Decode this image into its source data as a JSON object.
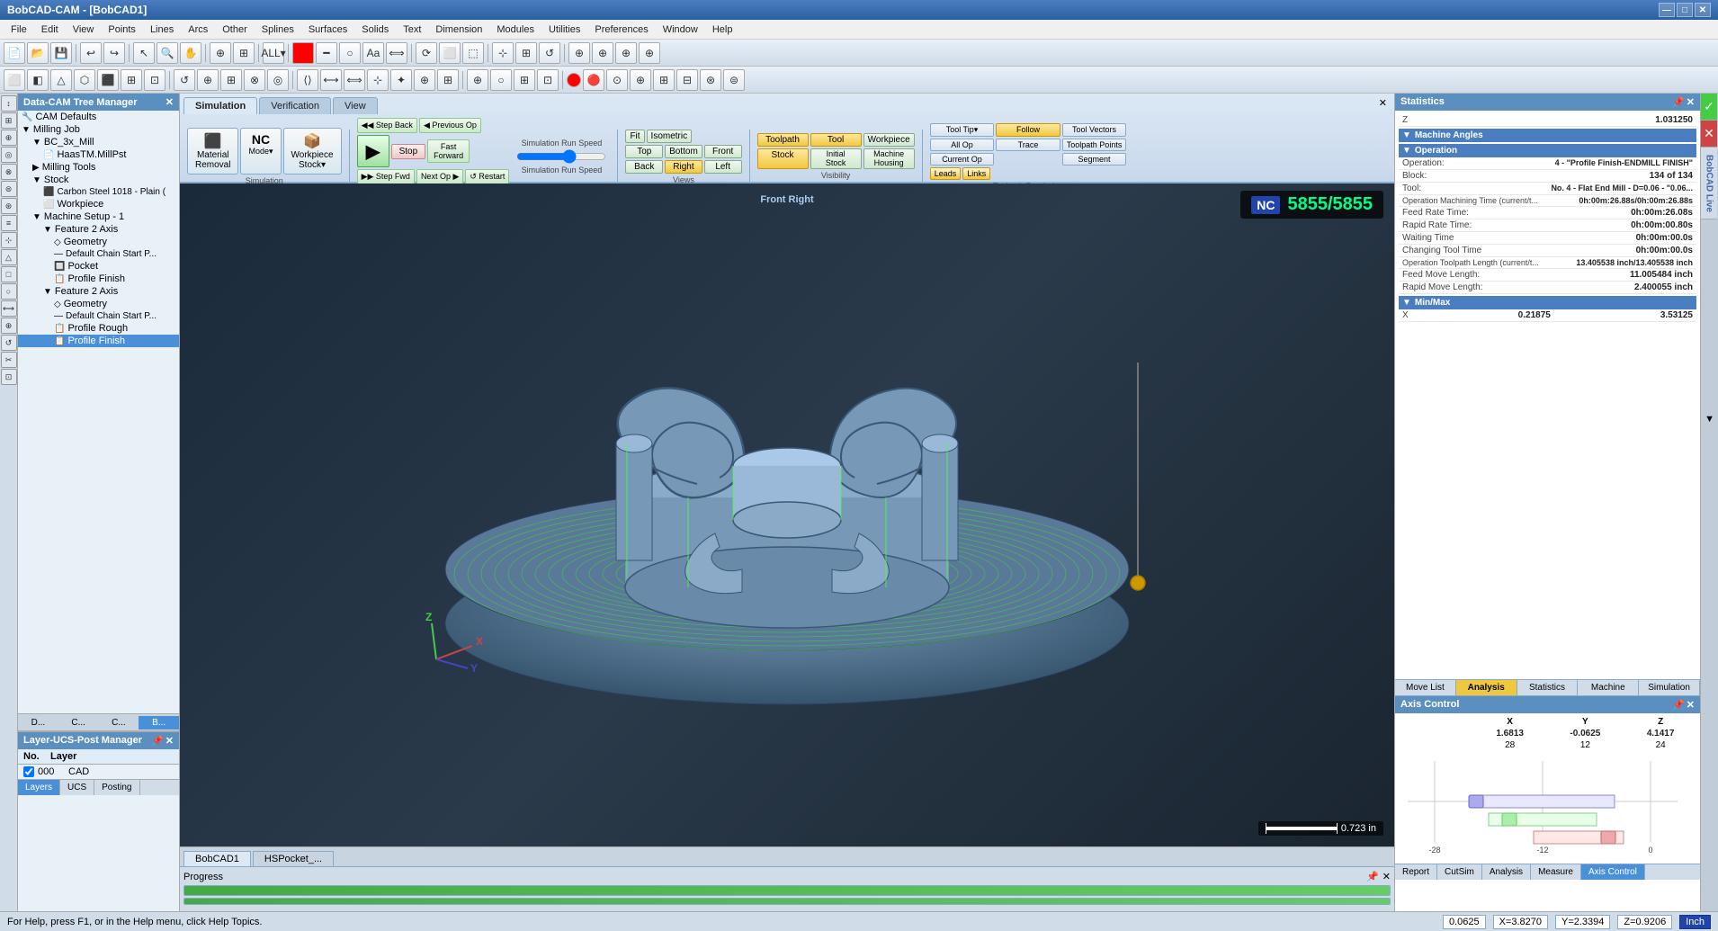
{
  "app": {
    "title": "BobCAD-CAM - [BobCAD1]",
    "min_label": "—",
    "max_label": "□",
    "close_label": "✕"
  },
  "menubar": {
    "items": [
      "File",
      "Edit",
      "View",
      "Points",
      "Lines",
      "Arcs",
      "Other",
      "Splines",
      "Surfaces",
      "Solids",
      "Text",
      "Dimension",
      "Modules",
      "Utilities",
      "Preferences",
      "Window",
      "Help"
    ]
  },
  "simulation": {
    "tabs": [
      "Simulation",
      "Verification",
      "View"
    ],
    "active_tab": "Simulation",
    "buttons": {
      "material_removal": "Material\nRemoval",
      "nc_mode": "NC\nMode",
      "workpiece_stock": "Workpiece\nStock",
      "step_back": "◀◀ Step Back",
      "previous_op": "◀ Previous Op",
      "run": "▶",
      "stop": "Stop",
      "fast_forward": "Fast\nForward",
      "step_fwd": "▶▶ Step Fwd",
      "next_op": "Next Op ▶",
      "restart": "↺ Restart"
    },
    "speed_label": "Simulation Run Speed",
    "views": {
      "top": "Top",
      "bottom": "Bottom",
      "front": "Front",
      "back": "Back",
      "right": "Right",
      "left": "Left",
      "fit": "Fit",
      "isometric": "Isometric"
    },
    "visibility": {
      "toolpath": "Toolpath",
      "tool": "Tool",
      "workpiece": "Workpiece",
      "stock": "Stock",
      "initial_stock": "Initial\nStock",
      "machine_housing": "Machine\nHousing"
    },
    "toolpath_rendering": {
      "tool_tip": "Tool Tip ▾",
      "follow": "Follow",
      "tool_vectors": "Tool Vectors",
      "leads": "Leads",
      "all_op": "All Op",
      "trace": "Trace",
      "toolpath_points": "Toolpath Points",
      "links": "Links",
      "current_op": "Current Op",
      "segment": "Segment"
    }
  },
  "nc_counter": {
    "badge": "NC",
    "value": "5855/5855"
  },
  "scale_bar": {
    "label": "0.723 in"
  },
  "progress": {
    "title": "Progress",
    "bar1_pct": 100,
    "bar2_pct": 100
  },
  "cam_tree": {
    "title": "Data-CAM Tree Manager",
    "items": [
      {
        "label": "CAM Defaults",
        "indent": 0,
        "icon": "🔧"
      },
      {
        "label": "Milling Job",
        "indent": 0,
        "icon": "📁"
      },
      {
        "label": "BC_3x_Mill",
        "indent": 1,
        "icon": "🔩"
      },
      {
        "label": "HaasTM.MillPst",
        "indent": 2,
        "icon": "📄"
      },
      {
        "label": "Milling Tools",
        "indent": 1,
        "icon": "🔧"
      },
      {
        "label": "Stock",
        "indent": 1,
        "icon": "📦"
      },
      {
        "label": "Carbon Steel 1018 - Plain (",
        "indent": 2,
        "icon": "⬛"
      },
      {
        "label": "Workpiece",
        "indent": 2,
        "icon": "⬜"
      },
      {
        "label": "Machine Setup - 1",
        "indent": 1,
        "icon": "⚙"
      },
      {
        "label": "Feature 2 Axis",
        "indent": 2,
        "icon": "📂"
      },
      {
        "label": "Geometry",
        "indent": 3,
        "icon": "◇"
      },
      {
        "label": "Default Chain Start P...",
        "indent": 3,
        "icon": "—"
      },
      {
        "label": "Pocket",
        "indent": 3,
        "icon": "🔲"
      },
      {
        "label": "Profile Finish",
        "indent": 3,
        "icon": "📋"
      },
      {
        "label": "Feature 2 Axis",
        "indent": 2,
        "icon": "📂"
      },
      {
        "label": "Geometry",
        "indent": 3,
        "icon": "◇"
      },
      {
        "label": "Default Chain Start P...",
        "indent": 3,
        "icon": "—"
      },
      {
        "label": "Profile Rough",
        "indent": 3,
        "icon": "📋"
      },
      {
        "label": "Profile Finish",
        "indent": 3,
        "icon": "📋",
        "selected": true
      }
    ]
  },
  "layer_manager": {
    "title": "Layer-UCS-Post Manager",
    "columns": [
      "No.",
      "Layer"
    ],
    "rows": [
      {
        "no": "000",
        "layer": "CAD",
        "visible": true
      }
    ]
  },
  "left_tabs": [
    "Layers",
    "UCS",
    "Posting"
  ],
  "statistics": {
    "title": "Statistics",
    "machine_angles": {
      "label": "Machine Angles",
      "z_label": "Z",
      "z_value": "1.031250"
    },
    "operation": {
      "label": "Operation",
      "rows": [
        {
          "label": "Operation:",
          "value": "4 - \"Profile Finish-ENDMILL FINISH\""
        },
        {
          "label": "Block:",
          "value": "134 of 134"
        },
        {
          "label": "Tool:",
          "value": "No. 4 - Flat End Mill - D=0.06 - \"0.06..."
        },
        {
          "label": "Operation Machining Time (current/t...",
          "value": "0h:00m:26.88s/0h:00m:26.88s"
        },
        {
          "label": "Feed Rate Time:",
          "value": "0h:00m:26.08s"
        },
        {
          "label": "Rapid Rate Time:",
          "value": "0h:00m:00.80s"
        },
        {
          "label": "Waiting Time",
          "value": "0h:00m:00.0s"
        },
        {
          "label": "Changing Tool Time",
          "value": "0h:00m:00.0s"
        },
        {
          "label": "Operation Toolpath Length (current/t...",
          "value": "13.405538 inch/13.405538 inch"
        },
        {
          "label": "Feed Move Length:",
          "value": "11.005484 inch"
        },
        {
          "label": "Rapid Move Length:",
          "value": "2.400055 inch"
        }
      ]
    },
    "minmax": {
      "label": "Min/Max",
      "x_min": "0.21875",
      "x_max": "3.53125"
    }
  },
  "stats_tabs": [
    "Move List",
    "Analysis",
    "Statistics",
    "Machine",
    "Simulation"
  ],
  "axis_control": {
    "title": "Axis Control",
    "axes": {
      "x_label": "X",
      "y_label": "Y",
      "z_label": "Z",
      "x_val": "1.6813",
      "y_val": "-0.0625",
      "z_val": "4.1417",
      "x_steps": "28",
      "y_steps": "12",
      "z_steps": "24"
    },
    "chart_labels": [
      "-28",
      "-12",
      "0"
    ]
  },
  "bottom_tabs": [
    "Report",
    "CutSim",
    "Analysis",
    "Measure",
    "Axis Control"
  ],
  "statusbar": {
    "help_text": "For Help, press F1, or in the Help menu, click Help Topics.",
    "coord1": "0.0625",
    "coord_x": "X=3.8270",
    "coord_y": "Y=2.3394",
    "coord_z": "Z=0.9206",
    "unit": "Inch"
  },
  "bottom_doc_tabs": [
    "BobCAD1",
    "HSPocket_..."
  ],
  "viewport_front_right": "Front Right"
}
